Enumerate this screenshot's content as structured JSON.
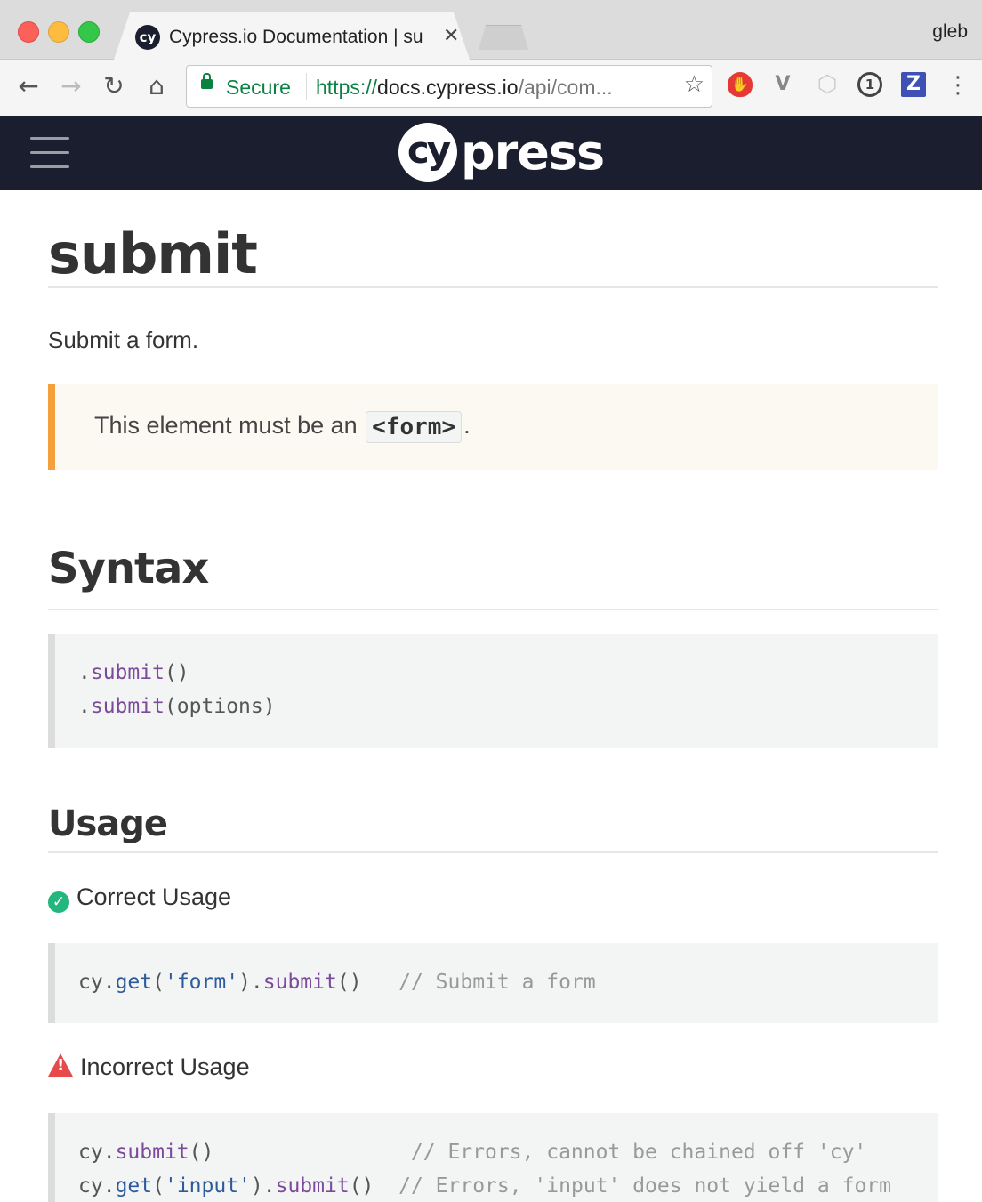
{
  "browser": {
    "tab": {
      "favicon_text": "cy",
      "title": "Cypress.io Documentation | su",
      "close": "✕"
    },
    "profile": "gleb",
    "nav": {
      "back": "←",
      "forward": "→",
      "reload": "↻",
      "home": "⌂"
    },
    "omnibox": {
      "secure_label": "Secure",
      "url_scheme": "https://",
      "url_host": "docs.cypress.io",
      "url_path": "/api/com..."
    },
    "extensions": {
      "ublock": "✋",
      "v": "V",
      "hex": "⬡",
      "onepassword": "1",
      "z": "Z"
    },
    "star": "☆",
    "menu": "⋮"
  },
  "site": {
    "logo_badge": "cy",
    "logo_text": "press"
  },
  "page": {
    "title": "submit",
    "lead": "Submit a form.",
    "note": {
      "before": "This element must be an",
      "code": "<form>",
      "after": "."
    },
    "syntax_heading": "Syntax",
    "syntax_lines": [
      {
        "pre": ".",
        "fn": "submit",
        "post": "()"
      },
      {
        "pre": ".",
        "fn": "submit",
        "post": "(options)"
      }
    ],
    "usage_heading": "Usage",
    "correct_heading": "Correct Usage",
    "correct_code": {
      "obj": "cy",
      "dot1": ".",
      "get": "get",
      "open": "(",
      "arg": "'form'",
      "close": ").",
      "fn": "submit",
      "call": "()",
      "comment": "// Submit a form"
    },
    "incorrect_heading": "Incorrect Usage",
    "incorrect_code": [
      {
        "obj": "cy",
        "dot1": ".",
        "fn": "submit",
        "call": "()",
        "comment": "// Errors, cannot be chained off 'cy'"
      },
      {
        "obj": "cy",
        "dot1": ".",
        "get": "get",
        "open": "(",
        "arg": "'input'",
        "close": ").",
        "fn": "submit",
        "call": "()",
        "comment": "// Errors, 'input' does not yield a form"
      }
    ]
  },
  "colors": {
    "header_bg": "#1b1e2e",
    "note_border": "#f5a03b",
    "check": "#23b77d",
    "warn": "#e64a4a",
    "secure_green": "#0b8043"
  }
}
